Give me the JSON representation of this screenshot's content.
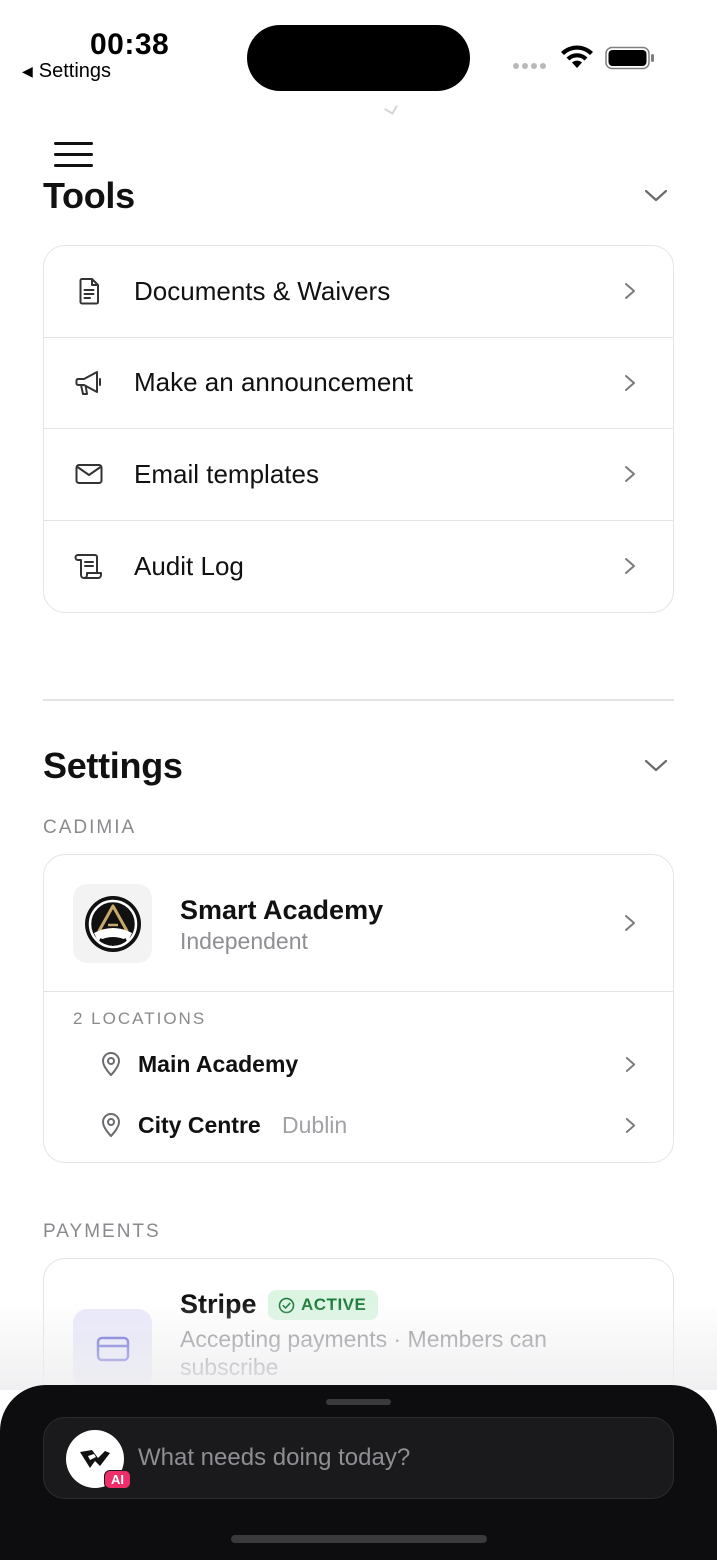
{
  "status_bar": {
    "time": "00:38",
    "back_label": "Settings"
  },
  "tools": {
    "title": "Tools",
    "items": [
      {
        "label": "Documents & Waivers",
        "icon": "document-icon"
      },
      {
        "label": "Make an announcement",
        "icon": "megaphone-icon"
      },
      {
        "label": "Email templates",
        "icon": "mail-icon"
      },
      {
        "label": "Audit Log",
        "icon": "scroll-icon"
      }
    ]
  },
  "settings": {
    "title": "Settings",
    "org_label": "CADIMIA",
    "academy": {
      "name": "Smart Academy",
      "type": "Independent"
    },
    "locations_label": "2 LOCATIONS",
    "locations": [
      {
        "name": "Main Academy",
        "city": ""
      },
      {
        "name": "City Centre",
        "city": "Dublin"
      }
    ],
    "payments_label": "PAYMENTS",
    "stripe": {
      "name": "Stripe",
      "status": "ACTIVE",
      "description": "Accepting payments · Members can subscribe"
    }
  },
  "assistant": {
    "placeholder": "What needs doing today?",
    "badge": "AI"
  },
  "colors": {
    "accent_green": "#1e7a3c",
    "badge_pink": "#ee2e68",
    "stripe_purple": "#5b5bd6"
  }
}
